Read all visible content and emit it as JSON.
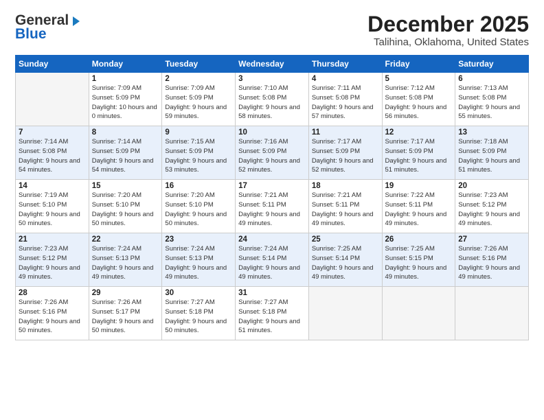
{
  "header": {
    "logo_line1": "General",
    "logo_line2": "Blue",
    "month": "December 2025",
    "location": "Talihina, Oklahoma, United States"
  },
  "weekdays": [
    "Sunday",
    "Monday",
    "Tuesday",
    "Wednesday",
    "Thursday",
    "Friday",
    "Saturday"
  ],
  "weeks": [
    [
      {
        "day": "",
        "empty": true
      },
      {
        "day": "1",
        "sunrise": "7:09 AM",
        "sunset": "5:09 PM",
        "daylight": "10 hours and 0 minutes."
      },
      {
        "day": "2",
        "sunrise": "7:09 AM",
        "sunset": "5:09 PM",
        "daylight": "9 hours and 59 minutes."
      },
      {
        "day": "3",
        "sunrise": "7:10 AM",
        "sunset": "5:08 PM",
        "daylight": "9 hours and 58 minutes."
      },
      {
        "day": "4",
        "sunrise": "7:11 AM",
        "sunset": "5:08 PM",
        "daylight": "9 hours and 57 minutes."
      },
      {
        "day": "5",
        "sunrise": "7:12 AM",
        "sunset": "5:08 PM",
        "daylight": "9 hours and 56 minutes."
      },
      {
        "day": "6",
        "sunrise": "7:13 AM",
        "sunset": "5:08 PM",
        "daylight": "9 hours and 55 minutes."
      }
    ],
    [
      {
        "day": "7",
        "sunrise": "7:14 AM",
        "sunset": "5:08 PM",
        "daylight": "9 hours and 54 minutes."
      },
      {
        "day": "8",
        "sunrise": "7:14 AM",
        "sunset": "5:09 PM",
        "daylight": "9 hours and 54 minutes."
      },
      {
        "day": "9",
        "sunrise": "7:15 AM",
        "sunset": "5:09 PM",
        "daylight": "9 hours and 53 minutes."
      },
      {
        "day": "10",
        "sunrise": "7:16 AM",
        "sunset": "5:09 PM",
        "daylight": "9 hours and 52 minutes."
      },
      {
        "day": "11",
        "sunrise": "7:17 AM",
        "sunset": "5:09 PM",
        "daylight": "9 hours and 52 minutes."
      },
      {
        "day": "12",
        "sunrise": "7:17 AM",
        "sunset": "5:09 PM",
        "daylight": "9 hours and 51 minutes."
      },
      {
        "day": "13",
        "sunrise": "7:18 AM",
        "sunset": "5:09 PM",
        "daylight": "9 hours and 51 minutes."
      }
    ],
    [
      {
        "day": "14",
        "sunrise": "7:19 AM",
        "sunset": "5:10 PM",
        "daylight": "9 hours and 50 minutes."
      },
      {
        "day": "15",
        "sunrise": "7:20 AM",
        "sunset": "5:10 PM",
        "daylight": "9 hours and 50 minutes."
      },
      {
        "day": "16",
        "sunrise": "7:20 AM",
        "sunset": "5:10 PM",
        "daylight": "9 hours and 50 minutes."
      },
      {
        "day": "17",
        "sunrise": "7:21 AM",
        "sunset": "5:11 PM",
        "daylight": "9 hours and 49 minutes."
      },
      {
        "day": "18",
        "sunrise": "7:21 AM",
        "sunset": "5:11 PM",
        "daylight": "9 hours and 49 minutes."
      },
      {
        "day": "19",
        "sunrise": "7:22 AM",
        "sunset": "5:11 PM",
        "daylight": "9 hours and 49 minutes."
      },
      {
        "day": "20",
        "sunrise": "7:23 AM",
        "sunset": "5:12 PM",
        "daylight": "9 hours and 49 minutes."
      }
    ],
    [
      {
        "day": "21",
        "sunrise": "7:23 AM",
        "sunset": "5:12 PM",
        "daylight": "9 hours and 49 minutes."
      },
      {
        "day": "22",
        "sunrise": "7:24 AM",
        "sunset": "5:13 PM",
        "daylight": "9 hours and 49 minutes."
      },
      {
        "day": "23",
        "sunrise": "7:24 AM",
        "sunset": "5:13 PM",
        "daylight": "9 hours and 49 minutes."
      },
      {
        "day": "24",
        "sunrise": "7:24 AM",
        "sunset": "5:14 PM",
        "daylight": "9 hours and 49 minutes."
      },
      {
        "day": "25",
        "sunrise": "7:25 AM",
        "sunset": "5:14 PM",
        "daylight": "9 hours and 49 minutes."
      },
      {
        "day": "26",
        "sunrise": "7:25 AM",
        "sunset": "5:15 PM",
        "daylight": "9 hours and 49 minutes."
      },
      {
        "day": "27",
        "sunrise": "7:26 AM",
        "sunset": "5:16 PM",
        "daylight": "9 hours and 49 minutes."
      }
    ],
    [
      {
        "day": "28",
        "sunrise": "7:26 AM",
        "sunset": "5:16 PM",
        "daylight": "9 hours and 50 minutes."
      },
      {
        "day": "29",
        "sunrise": "7:26 AM",
        "sunset": "5:17 PM",
        "daylight": "9 hours and 50 minutes."
      },
      {
        "day": "30",
        "sunrise": "7:27 AM",
        "sunset": "5:18 PM",
        "daylight": "9 hours and 50 minutes."
      },
      {
        "day": "31",
        "sunrise": "7:27 AM",
        "sunset": "5:18 PM",
        "daylight": "9 hours and 51 minutes."
      },
      {
        "day": "",
        "empty": true
      },
      {
        "day": "",
        "empty": true
      },
      {
        "day": "",
        "empty": true
      }
    ]
  ],
  "labels": {
    "sunrise": "Sunrise:",
    "sunset": "Sunset:",
    "daylight": "Daylight:"
  }
}
